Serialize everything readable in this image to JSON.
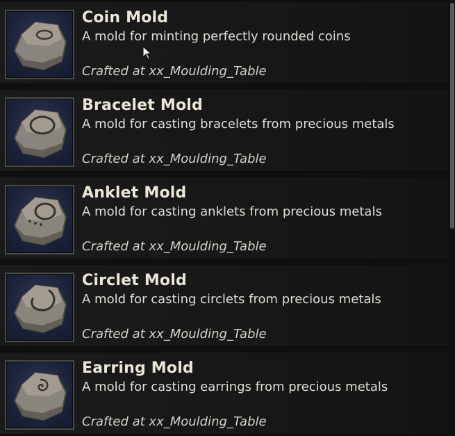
{
  "items": [
    {
      "title": "Coin Mold",
      "description": "A mold for minting perfectly rounded coins",
      "crafted_at": "Crafted at xx_Moulding_Table",
      "icon": "coin-mold-icon"
    },
    {
      "title": "Bracelet Mold",
      "description": "A mold for casting bracelets from precious metals",
      "crafted_at": "Crafted at xx_Moulding_Table",
      "icon": "bracelet-mold-icon"
    },
    {
      "title": "Anklet Mold",
      "description": "A mold for casting anklets from precious metals",
      "crafted_at": "Crafted at xx_Moulding_Table",
      "icon": "anklet-mold-icon"
    },
    {
      "title": "Circlet Mold",
      "description": "A mold for casting circlets from precious metals",
      "crafted_at": "Crafted at xx_Moulding_Table",
      "icon": "circlet-mold-icon"
    },
    {
      "title": "Earring Mold",
      "description": "A mold for casting earrings from precious metals",
      "crafted_at": "Crafted at xx_Moulding_Table",
      "icon": "earring-mold-icon"
    }
  ],
  "colors": {
    "title": "#ece6d8",
    "description": "#e1ddd4",
    "row_background": "#1b1b1c",
    "icon_background": "#1c2238",
    "stone": "#8a857c"
  }
}
